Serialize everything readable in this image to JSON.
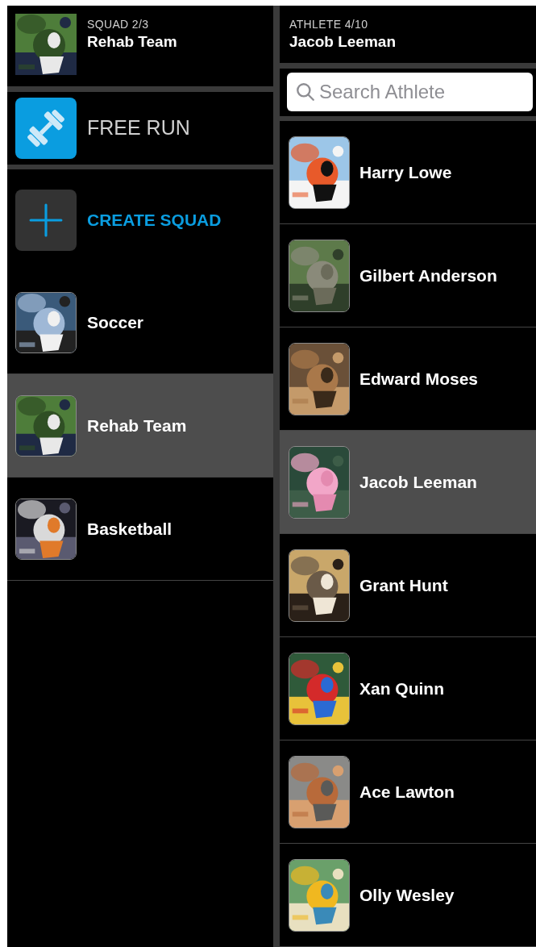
{
  "squad_header": {
    "caption": "SQUAD 2/3",
    "name": "Rehab Team"
  },
  "athlete_header": {
    "caption": "ATHLETE 4/10",
    "name": "Jacob Leeman"
  },
  "free_run": {
    "label": "FREE RUN"
  },
  "search": {
    "placeholder": "Search Athlete"
  },
  "create_squad": {
    "label": "CREATE SQUAD"
  },
  "squads": [
    {
      "name": "Soccer",
      "selected": false
    },
    {
      "name": "Rehab Team",
      "selected": true
    },
    {
      "name": "Basketball",
      "selected": false
    }
  ],
  "athletes": [
    {
      "name": "Harry Lowe",
      "selected": false
    },
    {
      "name": "Gilbert Anderson",
      "selected": false
    },
    {
      "name": "Edward Moses",
      "selected": false
    },
    {
      "name": "Jacob Leeman",
      "selected": true
    },
    {
      "name": "Grant Hunt",
      "selected": false
    },
    {
      "name": "Xan Quinn",
      "selected": false
    },
    {
      "name": "Ace Lawton",
      "selected": false
    },
    {
      "name": "Olly Wesley",
      "selected": false
    }
  ]
}
